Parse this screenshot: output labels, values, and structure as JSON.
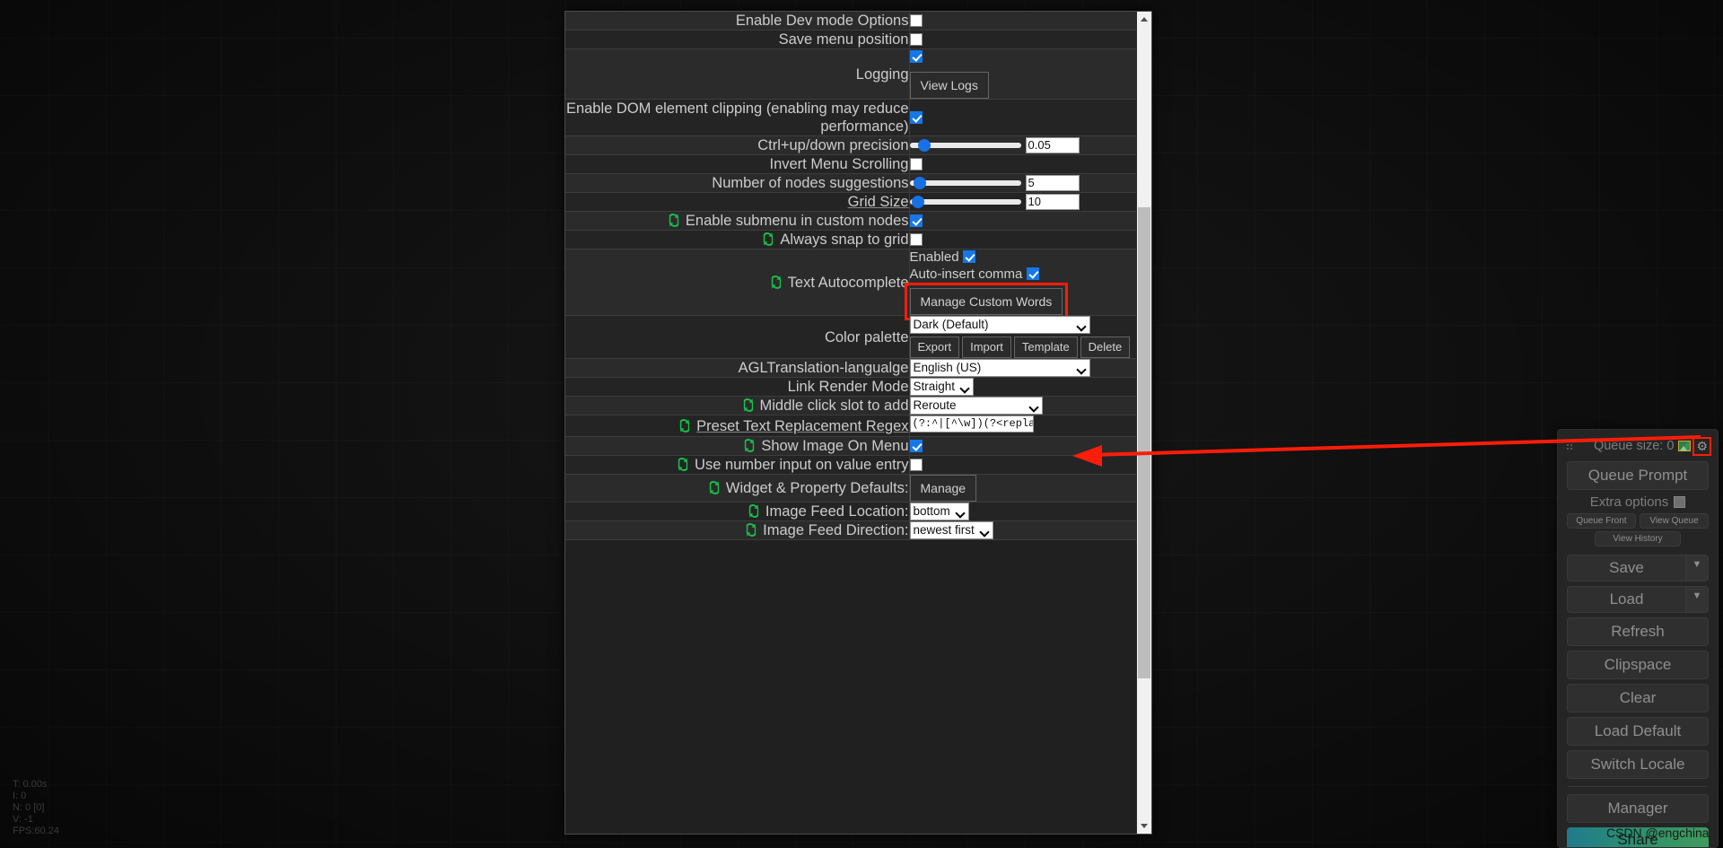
{
  "canvas": {
    "stats": "T: 0.00s\nI: 0\nN: 0 [0]\nV: -1\nFPS:60.24"
  },
  "settings": {
    "rows": [
      {
        "label": "Enable Dev mode Options",
        "ext": false,
        "type": "checkbox",
        "checked": false
      },
      {
        "label": "Save menu position",
        "ext": false,
        "type": "checkbox",
        "checked": false
      },
      {
        "label": "Logging",
        "ext": false,
        "type": "checkbox-button",
        "checked": true,
        "button": "View Logs"
      },
      {
        "label": "Enable DOM element clipping (enabling may reduce performance)",
        "ext": false,
        "type": "checkbox",
        "checked": true
      },
      {
        "label": "Ctrl+up/down precision",
        "ext": false,
        "type": "slider",
        "value": "0.05",
        "fill": 9
      },
      {
        "label": "Invert Menu Scrolling",
        "ext": false,
        "type": "checkbox",
        "checked": false
      },
      {
        "label": "Number of nodes suggestions",
        "ext": false,
        "type": "slider",
        "value": "5",
        "fill": 4
      },
      {
        "label": "Grid Size",
        "ext": false,
        "underline": true,
        "type": "slider",
        "value": "10",
        "fill": 2
      },
      {
        "label": "Enable submenu in custom nodes",
        "ext": true,
        "type": "checkbox",
        "checked": true
      },
      {
        "label": "Always snap to grid",
        "ext": true,
        "type": "checkbox",
        "checked": false
      },
      {
        "label": "Text Autocomplete",
        "ext": true,
        "type": "autocomplete",
        "enabled_label": "Enabled",
        "enabled_checked": true,
        "comma_label": "Auto-insert comma",
        "comma_checked": true,
        "button": "Manage Custom Words",
        "highlighted": true
      },
      {
        "label": "Color palette",
        "ext": false,
        "type": "palette",
        "selected": "Dark (Default)",
        "buttons": [
          "Export",
          "Import",
          "Template",
          "Delete"
        ]
      },
      {
        "label": "AGLTranslation-langualge",
        "ext": false,
        "type": "select-wide",
        "selected": "English (US)"
      },
      {
        "label": "Link Render Mode",
        "ext": false,
        "type": "select-fit",
        "selected": "Straight"
      },
      {
        "label": "Middle click slot to add",
        "ext": true,
        "type": "select-mid",
        "selected": "Reroute"
      },
      {
        "label": "Preset Text Replacement Regex",
        "ext": true,
        "underline": true,
        "type": "text",
        "value": "(?:^|[^\\w])(?<replace>@"
      },
      {
        "label": "Show Image On Menu",
        "ext": true,
        "type": "checkbox",
        "checked": true
      },
      {
        "label": "Use number input on value entry",
        "ext": true,
        "type": "checkbox",
        "checked": false
      },
      {
        "label": "Widget & Property Defaults:",
        "ext": true,
        "type": "button",
        "button": "Manage"
      },
      {
        "label": "Image Feed Location:",
        "ext": true,
        "type": "select-fit",
        "selected": "bottom"
      },
      {
        "label": "Image Feed Direction:",
        "ext": true,
        "type": "select-fit",
        "selected": "newest first"
      }
    ]
  },
  "comfy_menu": {
    "queue_size_label": "Queue size: 0",
    "queue_prompt": "Queue Prompt",
    "extra_options": "Extra options",
    "queue_front": "Queue Front",
    "view_queue": "View Queue",
    "view_history": "View History",
    "save": "Save",
    "load": "Load",
    "refresh": "Refresh",
    "clipspace": "Clipspace",
    "clear": "Clear",
    "load_default": "Load Default",
    "switch_locale": "Switch Locale",
    "manager": "Manager",
    "share": "Share",
    "caret": "▼"
  },
  "watermark": "CSDN @engchina",
  "colors": {
    "accent_blue": "#1577e8",
    "annotation_red": "#fc1d0a",
    "dialog_bg": "#202020",
    "row_bg": "#2b2b2b"
  }
}
